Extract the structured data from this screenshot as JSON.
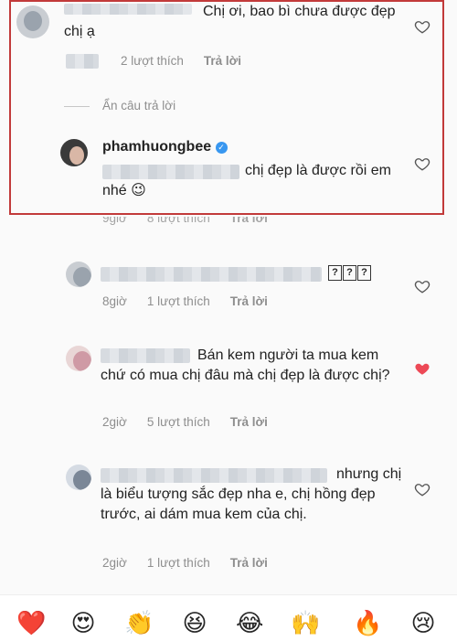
{
  "highlighted_comment": {
    "text": "Chị ơi, bao bì chưa được đẹp chị ạ",
    "likes": "2 lượt thích",
    "reply": "Trả lời",
    "hide_replies": "Ẩn câu trả lời"
  },
  "owner_reply": {
    "username": "phamhuongbee",
    "text": "chị đẹp là được rồi em nhé 😉",
    "time": "9giờ",
    "likes": "8 lượt thích",
    "reply": "Trả lời"
  },
  "comments": [
    {
      "text": "???",
      "time": "8giờ",
      "likes": "1 lượt thích",
      "reply": "Trả lời"
    },
    {
      "text": "Bán kem người ta mua kem chứ có mua chị đâu mà chị đẹp là được chị?",
      "time": "2giờ",
      "likes": "5 lượt thích",
      "reply": "Trả lời"
    },
    {
      "text": "nhưng chị là biểu tượng sắc đẹp nha e, chị hồng đẹp trước, ai dám mua kem của chị.",
      "time": "2giờ",
      "likes": "1 lượt thích",
      "reply": "Trả lời"
    }
  ],
  "emoji_bar": [
    "❤️",
    "😍",
    "👏",
    "😆",
    "😂",
    "🙌",
    "🔥",
    "😢"
  ],
  "colors": {
    "highlight_border": "#c23a3a",
    "liked_heart": "#ed4956",
    "meta_text": "#8e8e8e",
    "verified": "#3897f0"
  }
}
